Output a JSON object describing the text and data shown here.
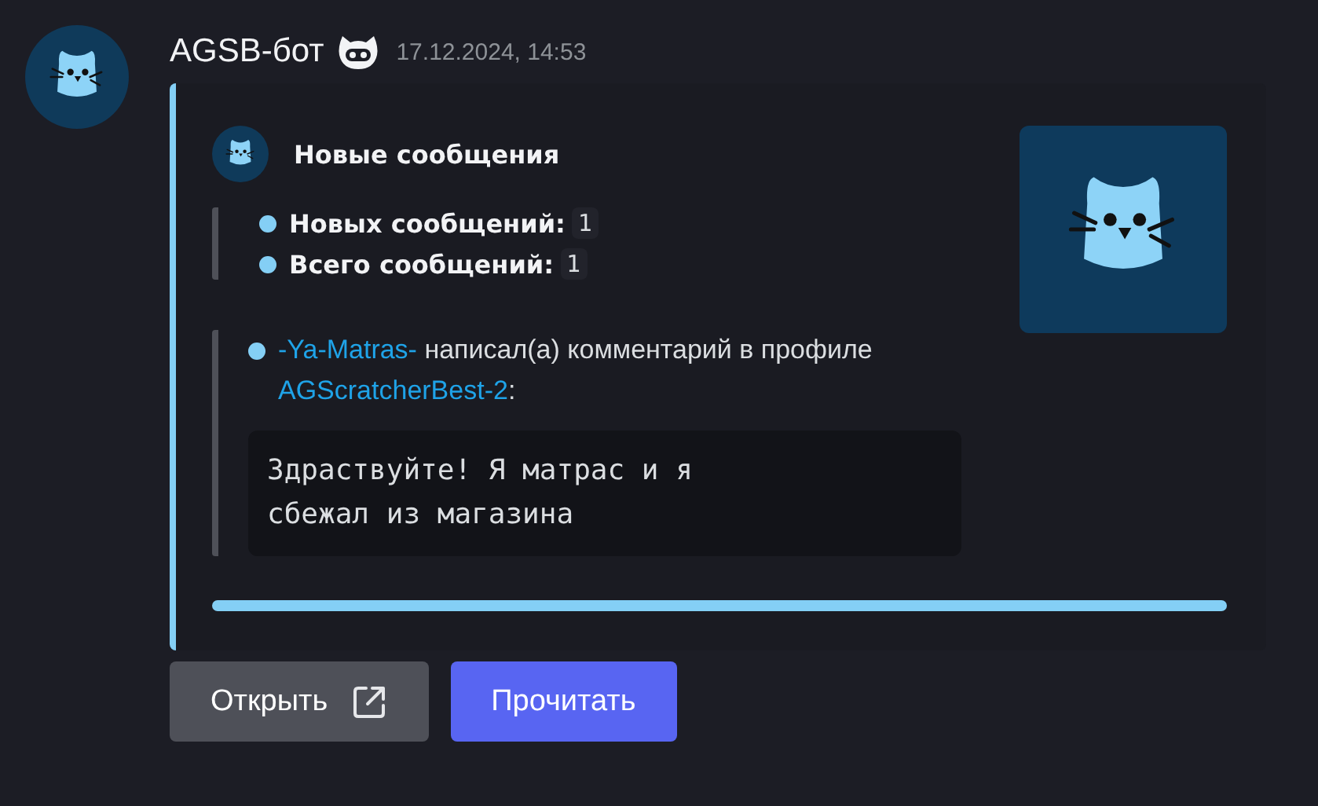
{
  "message": {
    "author": "AGSB-бот",
    "timestamp": "17.12.2024, 14:53",
    "bot": true
  },
  "embed": {
    "author_name": "Новые сообщения",
    "fields": [
      {
        "label": "Новых сообщений:",
        "value": "1"
      },
      {
        "label": "Всего сообщений:",
        "value": "1"
      }
    ],
    "comment": {
      "user": "-Ya-Matras-",
      "action": "написал(а) комментарий в профиле",
      "profile": "AGScratcherBest-2",
      "tail": ":"
    },
    "quote": "Здраствуйте! Я матрас и я\nсбежал из магазина"
  },
  "buttons": [
    {
      "label": "Открыть",
      "kind": "secondary",
      "external": true
    },
    {
      "label": "Прочитать",
      "kind": "primary",
      "external": false
    }
  ]
}
